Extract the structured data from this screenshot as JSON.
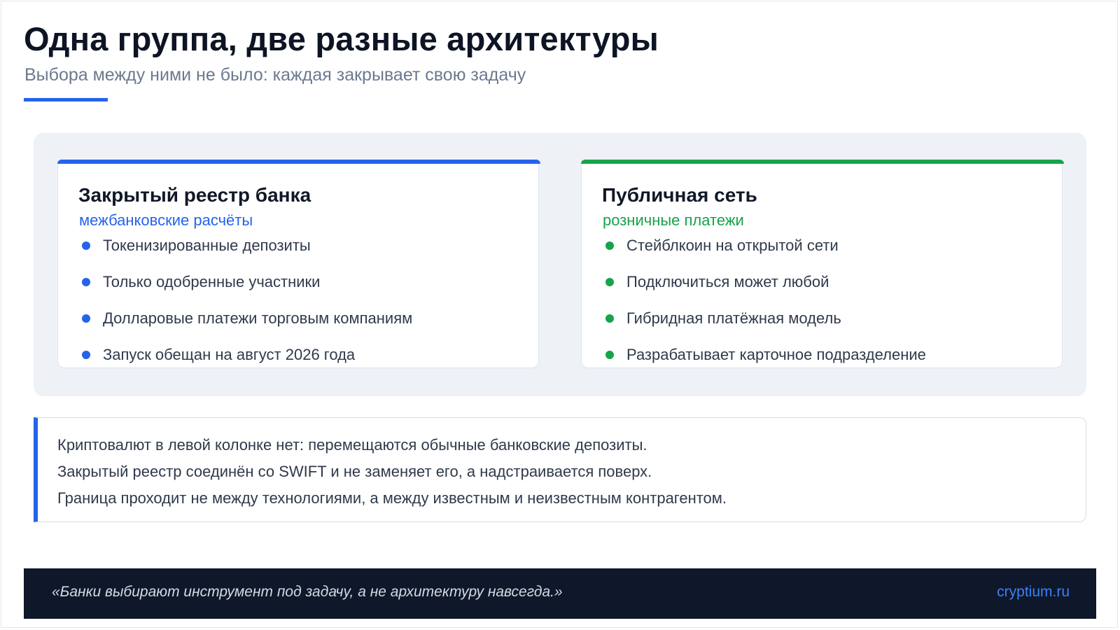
{
  "header": {
    "title": "Одна группа, две разные архитектуры",
    "subtitle": "Выбора между ними не было: каждая закрывает свою задачу"
  },
  "cards": [
    {
      "title": "Закрытый реестр банка",
      "tag": "межбанковские расчёты",
      "items": [
        "Токенизированные депозиты",
        "Только одобренные участники",
        "Долларовые платежи торговым компаниям",
        "Запуск обещан на август 2026 года"
      ]
    },
    {
      "title": "Публичная сеть",
      "tag": "розничные платежи",
      "items": [
        "Стейблкоин на открытой сети",
        "Подключиться может любой",
        "Гибридная платёжная модель",
        "Разрабатывает карточное подразделение"
      ]
    }
  ],
  "notes": [
    "Криптовалют в левой колонке нет: перемещаются обычные банковские депозиты.",
    "Закрытый реестр соединён со SWIFT и не заменяет его, а надстраивается поверх.",
    "Граница проходит не между технологиями, а между известным и неизвестным контрагентом."
  ],
  "footer": {
    "quote": "«Банки выбирают инструмент под задачу, а не архитектуру навсегда.»",
    "site": "cryptium.ru"
  },
  "colors": {
    "accent_blue": "#2563eb",
    "accent_green": "#16a34a",
    "footer_bg": "#0f172a"
  }
}
